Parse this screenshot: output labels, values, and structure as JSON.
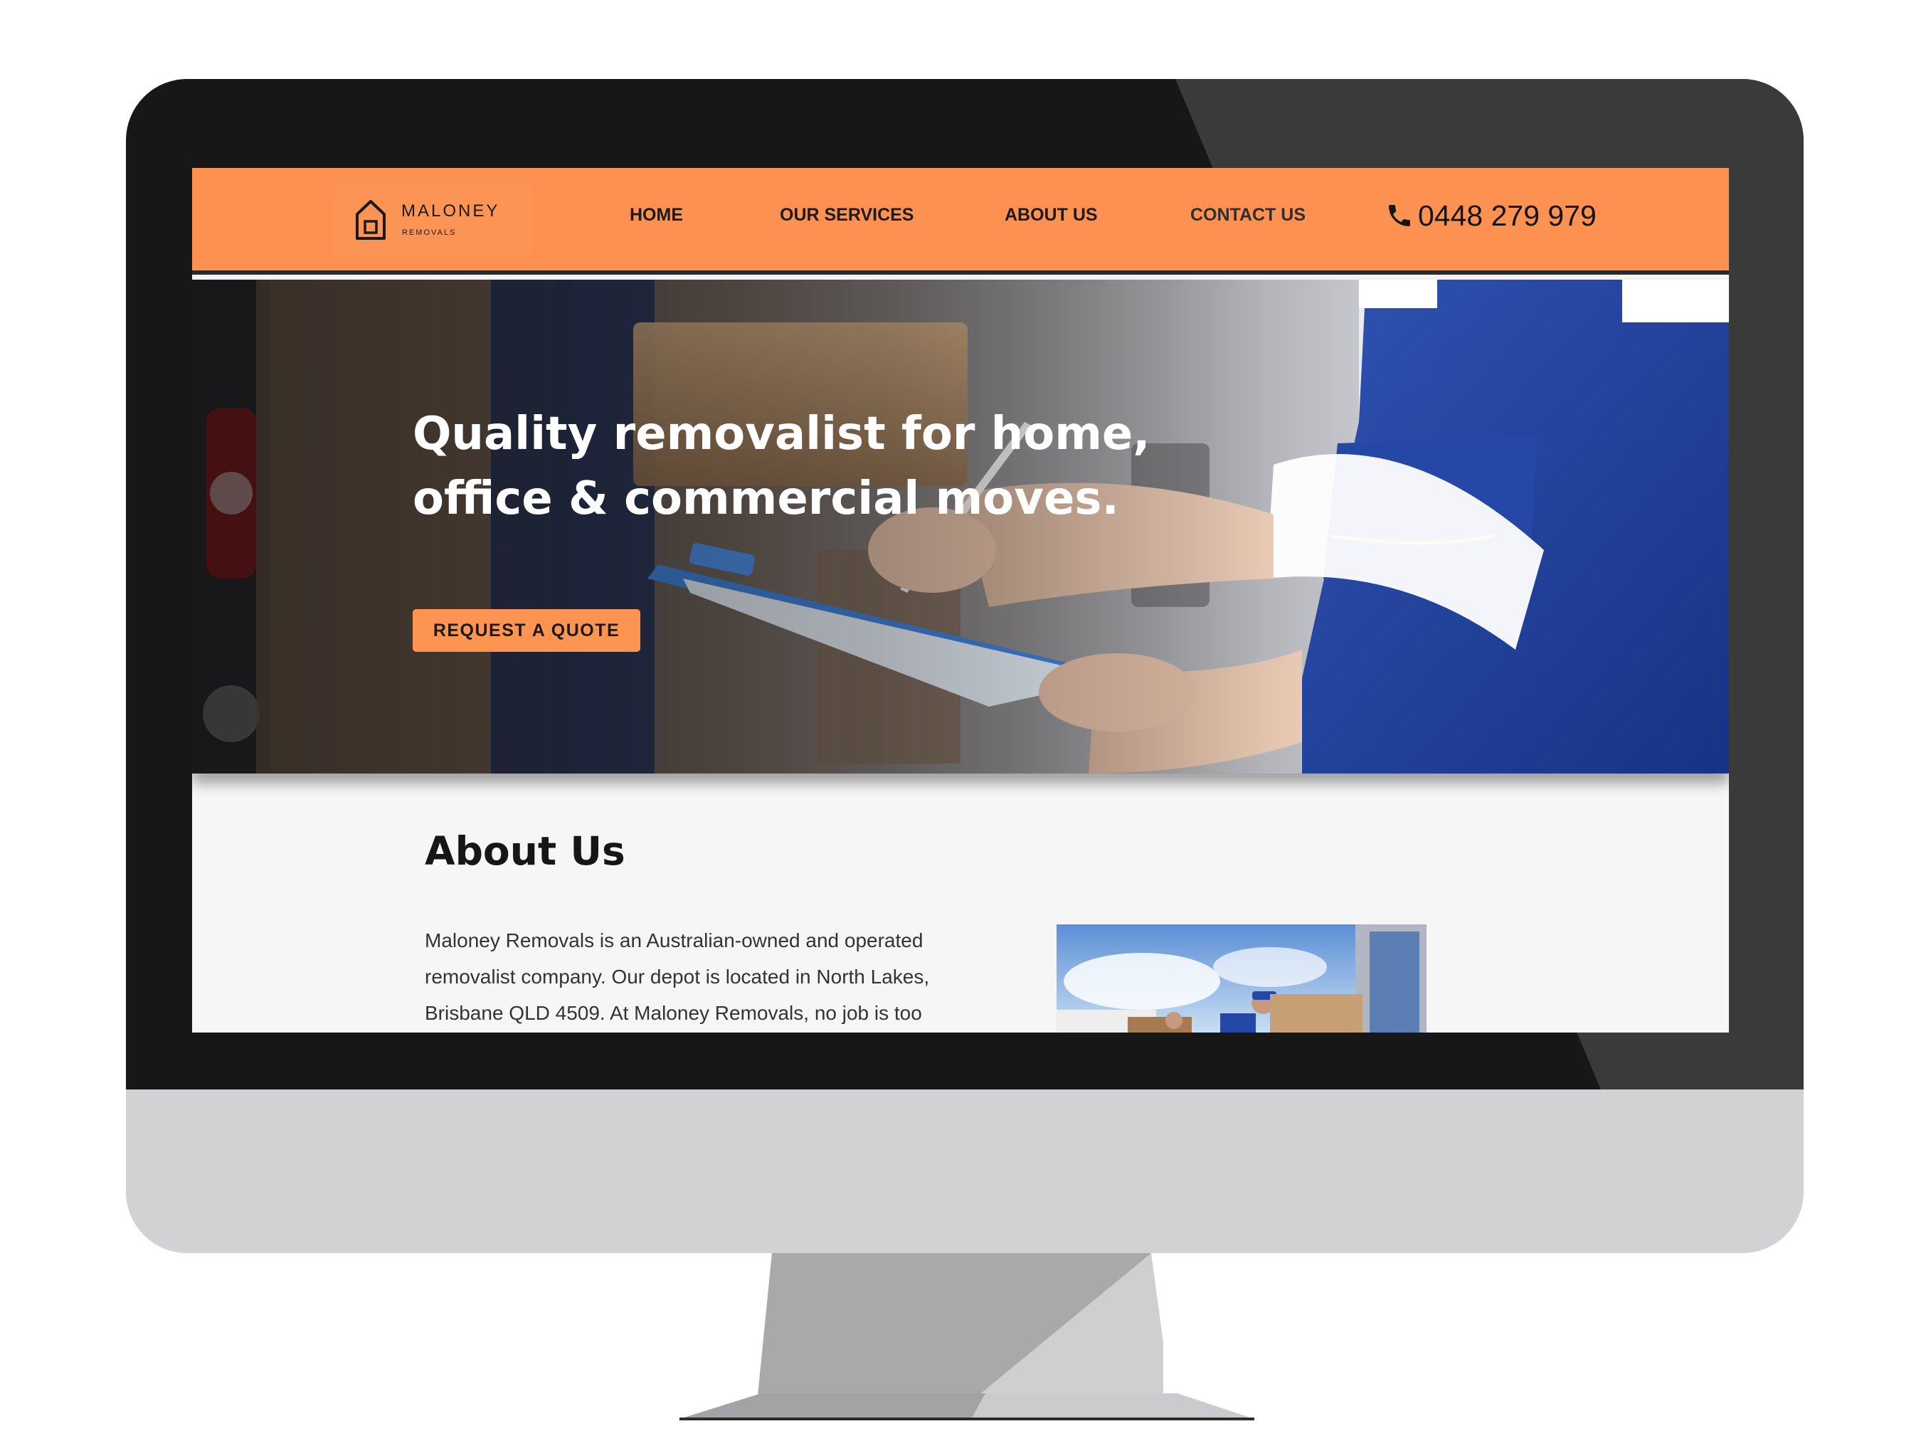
{
  "site": {
    "logo": {
      "name": "MALONEY",
      "sub": "REMOVALS"
    },
    "nav": {
      "home": "HOME",
      "services": "OUR SERVICES",
      "about": "ABOUT US",
      "contact": "CONTACT US"
    },
    "phone": "0448 279 979"
  },
  "hero": {
    "title": "Quality removalist for home, office & commercial moves.",
    "cta": "REQUEST A QUOTE"
  },
  "about": {
    "heading": "About Us",
    "text": "Maloney Removals is an Australian-owned and operated removalist company. Our depot is located in North Lakes, Brisbane QLD 4509. At Maloney Removals, no job is too"
  },
  "colors": {
    "brand_orange": "#fd9151",
    "bezel": "#171717",
    "chin": "#d1d2d4",
    "overall_blue": "#1f3f9a"
  },
  "icons": {
    "logo": "house-icon",
    "phone": "phone-icon",
    "camera": "camera-icon"
  }
}
